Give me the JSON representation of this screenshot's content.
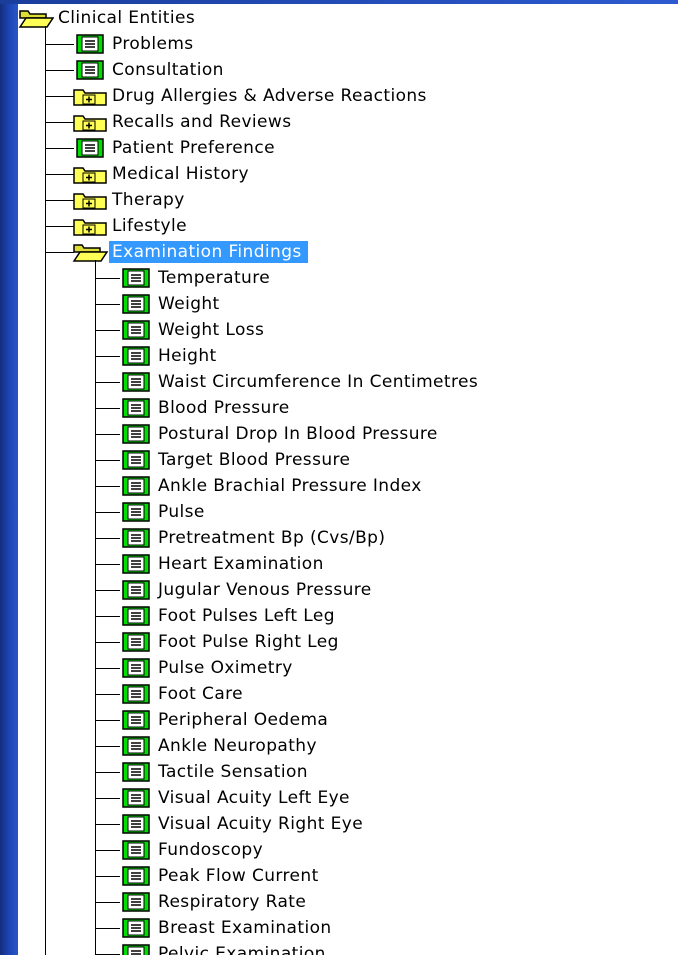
{
  "tree": {
    "root": {
      "label": "Clinical Entities",
      "icon": "folder-open-icon"
    },
    "items": [
      {
        "label": "Problems",
        "icon": "document-icon"
      },
      {
        "label": "Consultation",
        "icon": "document-icon"
      },
      {
        "label": "Drug Allergies & Adverse Reactions",
        "icon": "folder-expand-icon"
      },
      {
        "label": "Recalls and Reviews",
        "icon": "folder-expand-icon"
      },
      {
        "label": "Patient Preference",
        "icon": "document-icon"
      },
      {
        "label": "Medical History",
        "icon": "folder-expand-icon"
      },
      {
        "label": "Therapy",
        "icon": "folder-expand-icon"
      },
      {
        "label": "Lifestyle",
        "icon": "folder-expand-icon"
      },
      {
        "label": "Examination Findings",
        "icon": "folder-open-icon",
        "selected": true,
        "children": [
          "Temperature",
          "Weight",
          "Weight Loss",
          "Height",
          "Waist Circumference In Centimetres",
          "Blood Pressure",
          "Postural Drop In Blood Pressure",
          "Target Blood Pressure",
          "Ankle Brachial Pressure Index",
          "Pulse",
          "Pretreatment Bp (Cvs/Bp)",
          "Heart Examination",
          "Jugular Venous Pressure",
          "Foot Pulses Left Leg",
          "Foot Pulse Right Leg",
          "Pulse Oximetry",
          "Foot Care",
          "Peripheral Oedema",
          "Ankle Neuropathy",
          "Tactile Sensation",
          "Visual Acuity Left Eye",
          "Visual Acuity Right Eye",
          "Fundoscopy",
          "Peak Flow Current",
          "Respiratory Rate",
          "Breast Examination",
          "Pelvic Examination"
        ]
      }
    ]
  },
  "colors": {
    "selection": "#3399ff",
    "document_green": "#00dd00",
    "folder_yellow": "#ffff55",
    "frame_blue": "#1e47b7"
  }
}
